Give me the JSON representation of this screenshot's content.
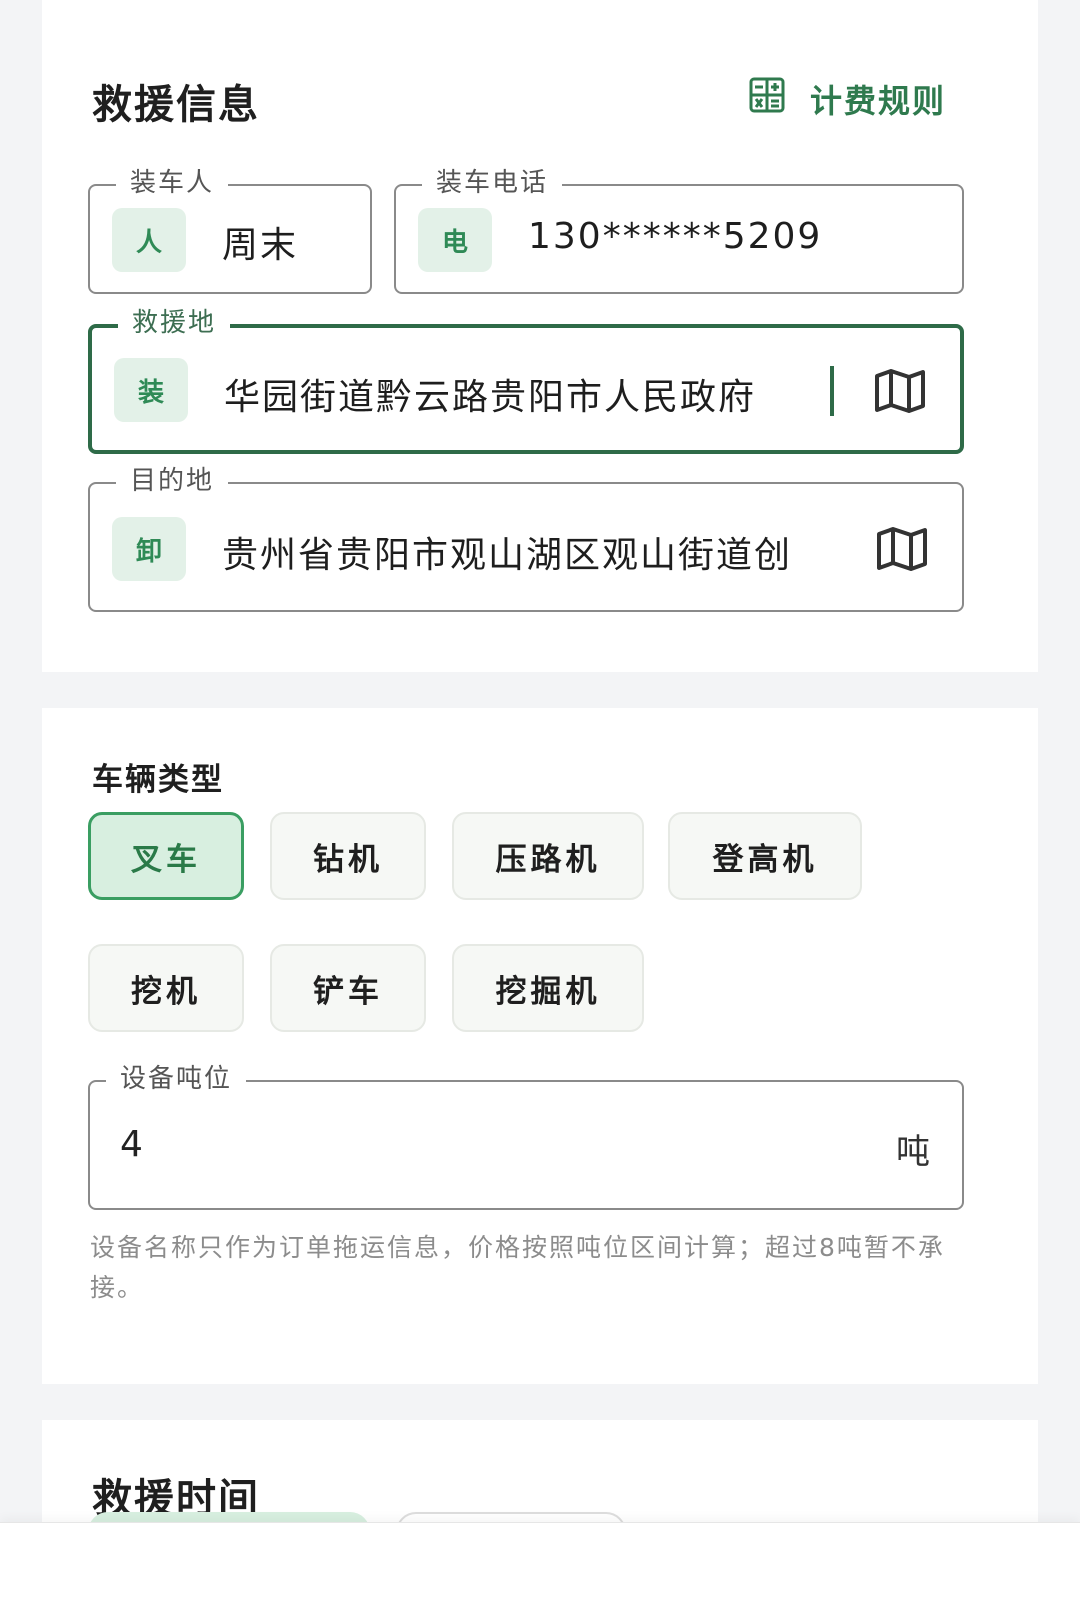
{
  "rescue_info": {
    "title": "救援信息",
    "fee_rules_label": "计费规则",
    "loader": {
      "label": "装车人",
      "badge": "人",
      "value": "周末"
    },
    "phone": {
      "label": "装车电话",
      "badge": "电",
      "value": "130******5209"
    },
    "rescue_location": {
      "label": "救援地",
      "badge": "装",
      "value": "华园街道黔云路贵阳市人民政府"
    },
    "destination": {
      "label": "目的地",
      "badge": "卸",
      "value": "贵州省贵阳市观山湖区观山街道创"
    }
  },
  "vehicle": {
    "title": "车辆类型",
    "types": [
      "叉车",
      "钻机",
      "压路机",
      "登高机",
      "挖机",
      "铲车",
      "挖掘机"
    ],
    "selected": "叉车",
    "tonnage": {
      "label": "设备吨位",
      "value": "4",
      "unit": "吨"
    },
    "hint": "设备名称只作为订单拖运信息，价格按照吨位区间计算；超过8吨暂不承接。"
  },
  "rescue_time": {
    "title": "救援时间"
  },
  "colors": {
    "accent": "#2e6b48",
    "chip_selected_bg": "#d8efe0",
    "badge_bg": "#e3f1e8"
  },
  "icons": {
    "fee_rules": "calculator-icon",
    "map": "map-icon"
  }
}
